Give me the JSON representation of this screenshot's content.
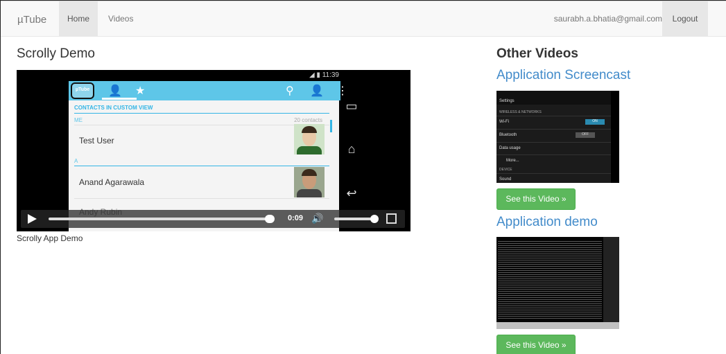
{
  "navbar": {
    "brand": "µTube",
    "home": "Home",
    "videos": "Videos",
    "email": "saurabh.a.bhatia@gmail.com",
    "logout": "Logout"
  },
  "main": {
    "title": "Scrolly Demo",
    "caption": "Scrolly App Demo",
    "video": {
      "status_time": "11:39",
      "section_header": "CONTACTS IN CUSTOM VIEW",
      "group_me": "ME",
      "count": "20 contacts",
      "group_a": "A",
      "contacts": [
        "Test User",
        "Anand Agarawala",
        "Andy Rubin"
      ],
      "elapsed": "0:09",
      "progress": 0.93,
      "volume": 0.85
    }
  },
  "sidebar": {
    "title": "Other Videos",
    "videos": [
      {
        "title": "Application Screencast",
        "button": "See this Video »"
      },
      {
        "title": "Application demo",
        "button": "See this Video »"
      }
    ],
    "settings_thumb": {
      "header": "Settings",
      "section": "WIRELESS & NETWORKS",
      "wifi": "Wi-Fi",
      "wifi_state": "ON",
      "bluetooth": "Bluetooth",
      "bluetooth_state": "OFF",
      "data_usage": "Data usage",
      "more": "More...",
      "device": "DEVICE",
      "sound": "Sound"
    }
  },
  "colors": {
    "accent": "#428bca",
    "button": "#5cb85c",
    "holo": "#33b5e5"
  }
}
